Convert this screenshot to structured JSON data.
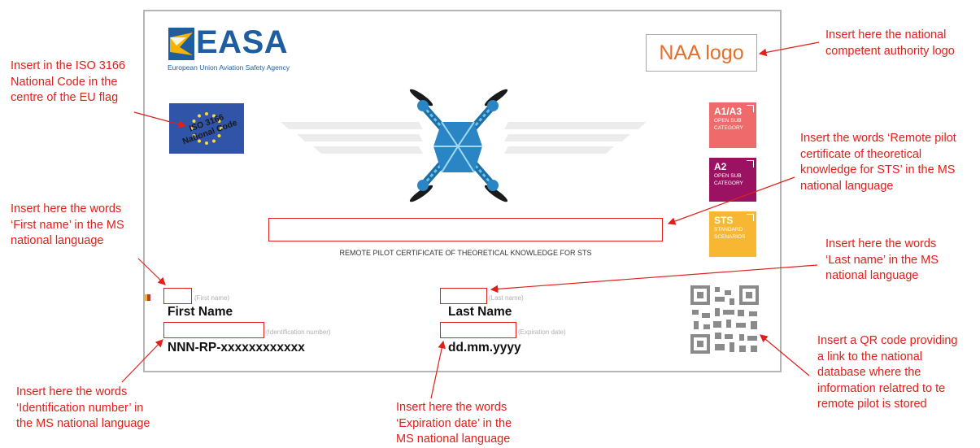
{
  "logo": {
    "name": "EASA",
    "tagline": "European Union Aviation Safety Agency"
  },
  "naa_logo_text": "NAA logo",
  "flag_text": [
    "ISO 3166",
    "National Code"
  ],
  "categories": [
    {
      "code": "A1/A3",
      "sub": [
        "OPEN SUB",
        "CATEGORY"
      ],
      "color": "#ef6b6b"
    },
    {
      "code": "A2",
      "sub": [
        "OPEN SUB",
        "CATEGORY"
      ],
      "color": "#9b1262"
    },
    {
      "code": "STS",
      "sub": [
        "STANDARD",
        "SCENARIOS"
      ],
      "color": "#f7b733"
    }
  ],
  "certificate_title": "REMOTE PILOT CERTIFICATE OF THEORETICAL KNOWLEDGE FOR STS",
  "fields": {
    "first_name": {
      "hint": "(First name)",
      "value": "First Name"
    },
    "last_name": {
      "hint": "(Last name)",
      "value": "Last Name"
    },
    "id_number": {
      "hint": "(Identification number)",
      "value": "NNN-RP-xxxxxxxxxxxx"
    },
    "expiration": {
      "hint": "(Expiration date)",
      "value": "dd.mm.yyyy"
    }
  },
  "annotations": {
    "iso_code": [
      "Insert in the ISO 3166",
      "National Code in the",
      "centre of the EU flag"
    ],
    "naa_logo": [
      "Insert here the national",
      "competent authority logo"
    ],
    "title": [
      "Insert the words ‘Remote pilot",
      "certificate of theoretical",
      "knowledge for STS’  in the MS",
      "national language"
    ],
    "first_name": [
      "Insert here the words",
      "‘First name’ in the MS",
      "national language"
    ],
    "last_name": [
      "Insert here the words",
      "‘Last name’ in the MS",
      "national language"
    ],
    "id_number": [
      "Insert here the words",
      "‘Identification number’ in",
      "the MS national language"
    ],
    "expiration": [
      "Insert here the words",
      "‘Expiration date’ in the",
      "MS national language"
    ],
    "qr": [
      "Insert a QR code providing",
      "a link to the national",
      "database where the",
      "information relatred to te",
      "remote pilot is stored"
    ]
  },
  "colors": {
    "annotation": "#e0201b",
    "easa_blue": "#1e5d9f",
    "flag_blue": "#2f54a8",
    "naa_orange": "#e36f2c"
  }
}
